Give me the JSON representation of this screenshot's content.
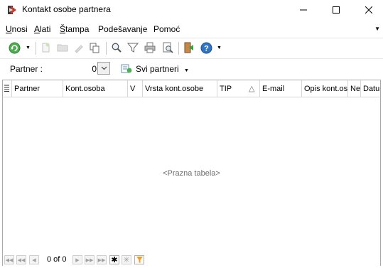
{
  "window": {
    "title": "Kontakt osobe partnera",
    "minimize_glyph": "—",
    "maximize_glyph": "☐",
    "close_glyph": "✕"
  },
  "menu": {
    "items": [
      {
        "label": "Unosi",
        "mnemonic": "U"
      },
      {
        "label": "Alati",
        "mnemonic": "A"
      },
      {
        "label": "Štampa",
        "mnemonic": "Š"
      },
      {
        "label": "Podešavanje",
        "mnemonic": ""
      },
      {
        "label": "Pomoć",
        "mnemonic": ""
      }
    ]
  },
  "toolbar": {
    "icons": [
      {
        "name": "refresh-icon",
        "enabled": true
      },
      {
        "name": "new-icon",
        "enabled": false
      },
      {
        "name": "open-folder-icon",
        "enabled": false
      },
      {
        "name": "edit-icon",
        "enabled": false
      },
      {
        "name": "copy-icon",
        "enabled": true
      },
      {
        "name": "search-icon",
        "enabled": true
      },
      {
        "name": "filter-icon",
        "enabled": true
      },
      {
        "name": "print-icon",
        "enabled": true
      },
      {
        "name": "print-preview-icon",
        "enabled": true
      },
      {
        "name": "exit-icon",
        "enabled": true
      },
      {
        "name": "help-icon",
        "enabled": true
      }
    ]
  },
  "filter": {
    "partner_label": "Partner :",
    "partner_value": "0",
    "svi_label": "Svi partneri"
  },
  "grid": {
    "columns": [
      "Partner",
      "Kont.osoba",
      "V",
      "Vrsta kont.osobe",
      "TIP",
      "E-mail",
      "Opis kont.os",
      "Ne",
      "Datum"
    ],
    "sort_indicator": "△",
    "empty_text": "<Prazna tabela>"
  },
  "navigator": {
    "record_text": "0 of 0"
  },
  "colors": {
    "refresh": "#3ea34a",
    "help": "#2f74c9",
    "exit": "#c0392b",
    "filter_active": "#f29c1f"
  }
}
